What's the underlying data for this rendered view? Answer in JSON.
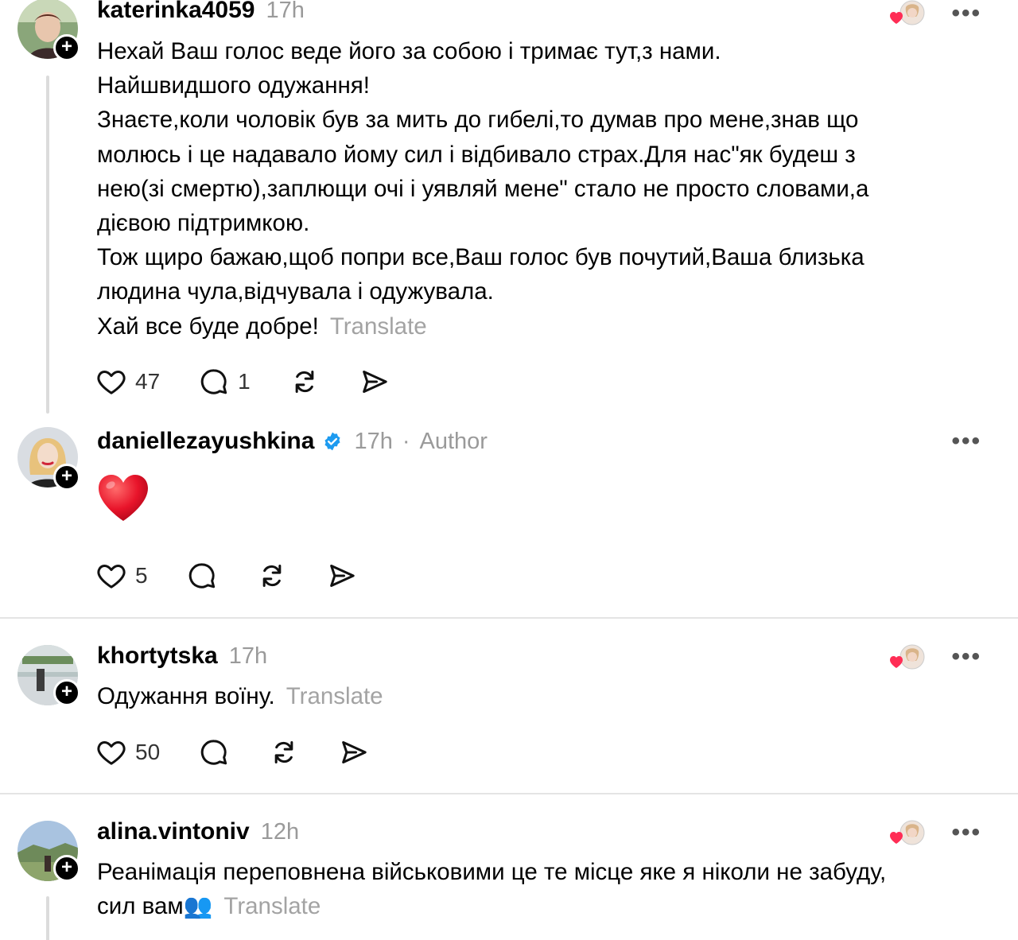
{
  "posts": [
    {
      "username": "katerinka4059",
      "time": "17h",
      "lines": [
        "Нехай Ваш голос веде його за собою і тримає тут,з нами.",
        "Найшвидшого одужання!",
        "Знаєте,коли чоловік був за мить до гибелі,то думав про мене,знав що",
        "молюсь і це надавало йому сил і відбивало страх.Для нас\"як будеш з",
        "нею(зі смертю),заплющи очі і уявляй мене\" стало не просто словами,а",
        "дієвою підтримкою.",
        "Тож щиро бажаю,щоб попри все,Ваш голос був почутий,Ваша близька",
        "людина чула,відчувала і одужувала.",
        "Хай все буде добре!"
      ],
      "translate": "Translate",
      "likes": "47",
      "replies": "1"
    },
    {
      "username": "daniellezayushkina",
      "time": "17h",
      "separator": "·",
      "author_label": "Author",
      "emoji": "❤️",
      "likes": "5"
    },
    {
      "username": "khortytska",
      "time": "17h",
      "text": "Одужання воїну.",
      "translate": "Translate",
      "likes": "50"
    },
    {
      "username": "alina.vintoniv",
      "time": "12h",
      "lines": [
        "Реанімація переповнена військовими це те місце яке я ніколи не забуду,",
        "сил вам👥"
      ],
      "translate": "Translate"
    }
  ],
  "more_label": "•••",
  "icons": {
    "like": "heart-icon",
    "reply": "comment-icon",
    "repost": "repost-icon",
    "share": "send-icon",
    "verified": "verified-badge-icon",
    "follow": "plus-icon"
  },
  "colors": {
    "verified": "#1d9bf0",
    "liked": "#ff2d55",
    "muted": "#9a9a9a"
  }
}
